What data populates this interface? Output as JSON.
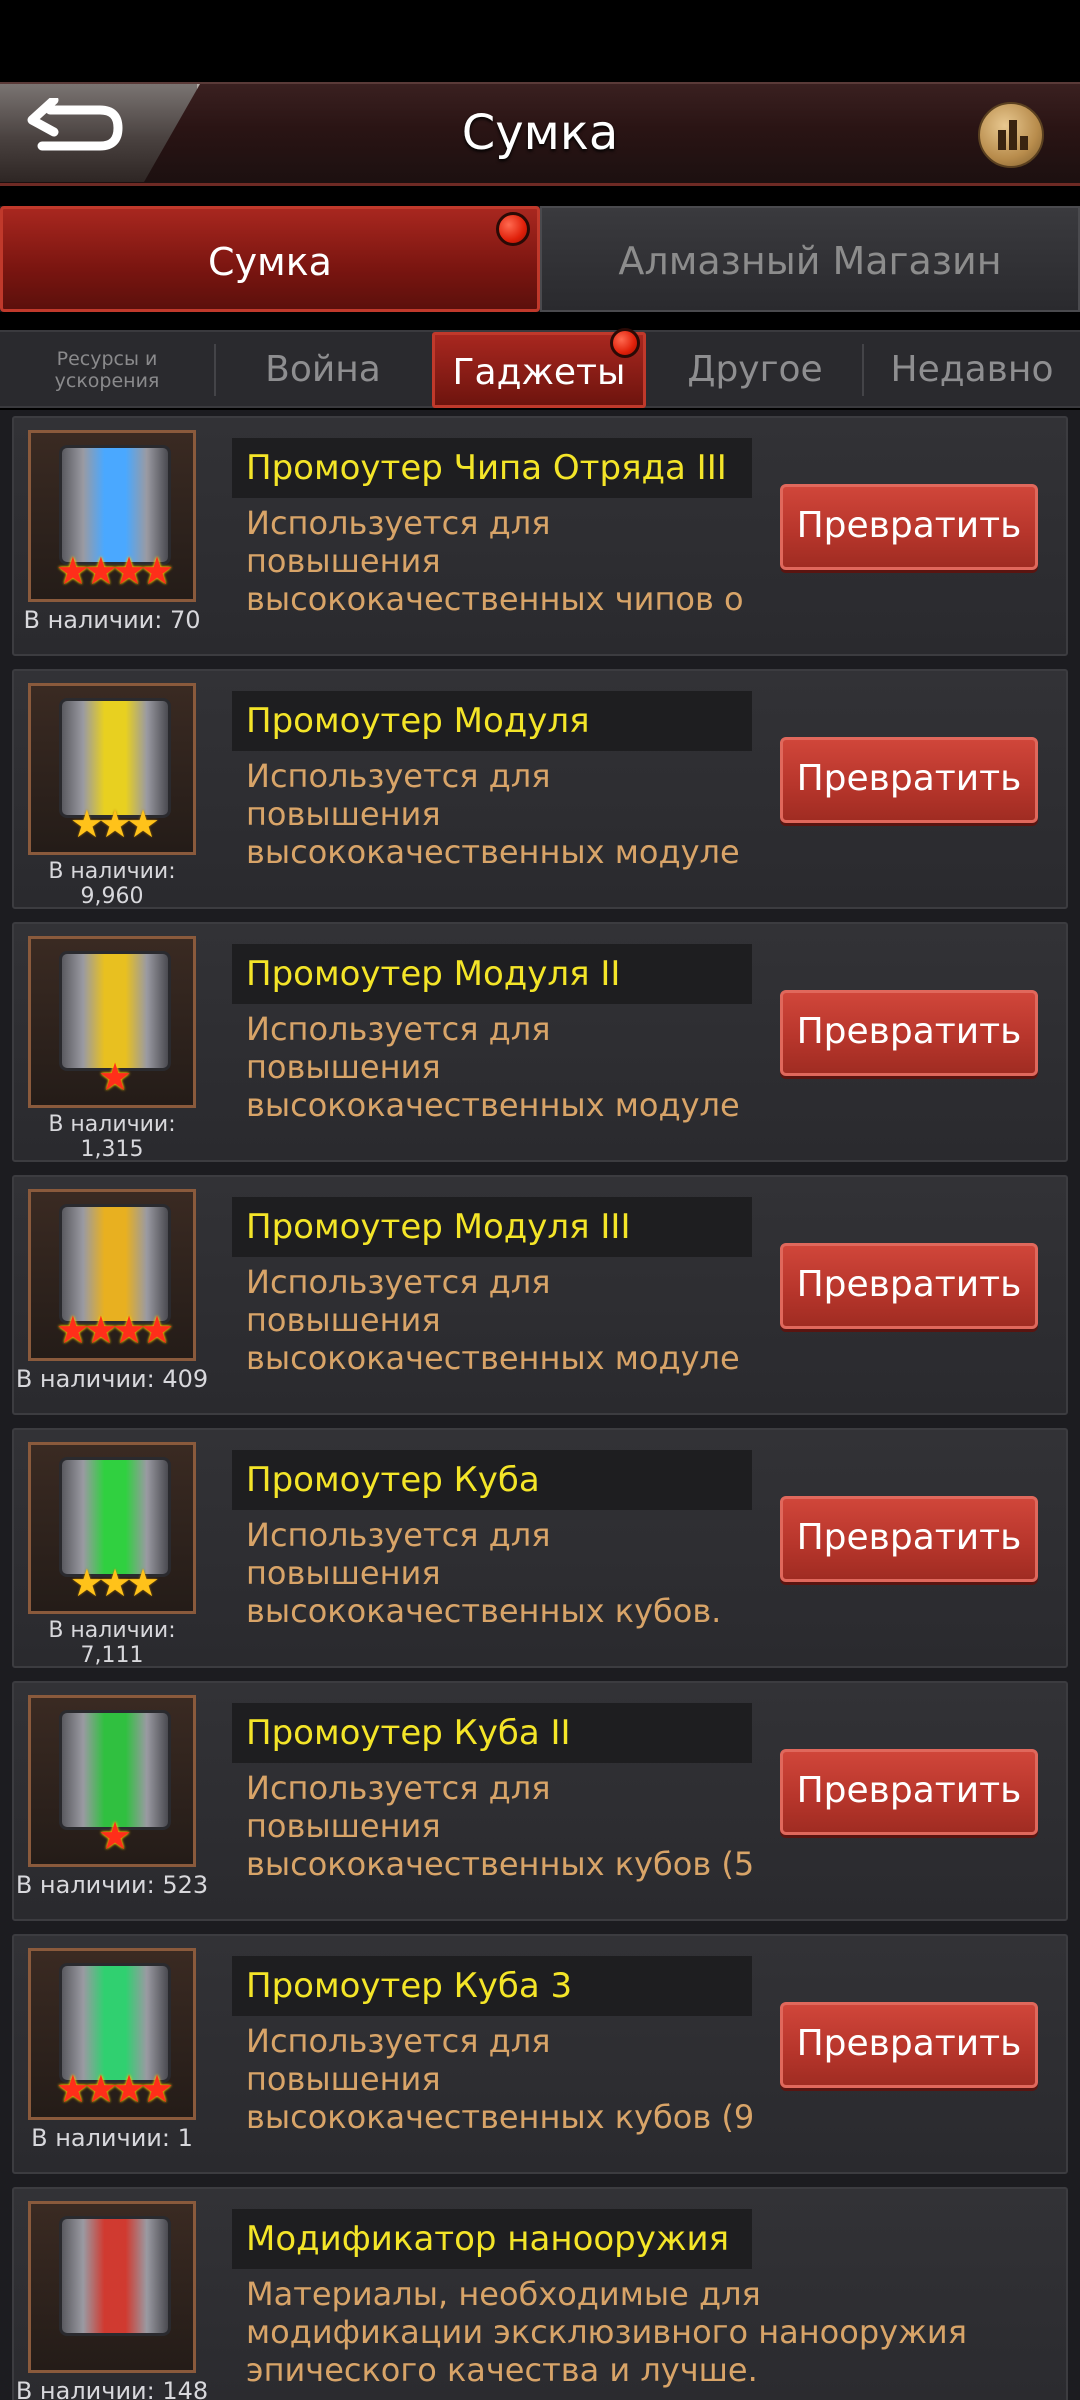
{
  "header": {
    "title": "Сумка",
    "back_icon": "back-arrow-icon",
    "stats_icon": "bar-chart-icon"
  },
  "top_tabs": [
    {
      "label": "Сумка",
      "active": true,
      "badge": true
    },
    {
      "label": "Алмазный Магазин",
      "active": false,
      "badge": false
    }
  ],
  "sub_tabs": [
    {
      "label": "Ресурсы и ускорения",
      "line1": "Ресурсы и",
      "line2": "ускорения",
      "active": false
    },
    {
      "label": "Война",
      "active": false
    },
    {
      "label": "Гаджеты",
      "active": true,
      "badge": true
    },
    {
      "label": "Другое",
      "active": false
    },
    {
      "label": "Недавно",
      "active": false
    }
  ],
  "convert_label": "Превратить",
  "items": [
    {
      "name": "Промоутер Чипа Отряда III",
      "desc": [
        "Используется для",
        "повышения",
        "высококачественных чипов о"
      ],
      "stock": "В наличии: 70",
      "stars": 4,
      "color": "#4aa8ff"
    },
    {
      "name": "Промоутер Модуля",
      "desc": [
        "Используется для",
        "повышения",
        "высококачественных модуле"
      ],
      "stock": "В наличии: 9,960",
      "stars": 3,
      "color": "#e8d020"
    },
    {
      "name": "Промоутер Модуля II",
      "desc": [
        "Используется для",
        "повышения",
        "высококачественных модуле"
      ],
      "stock": "В наличии: 1,315",
      "stars": 1,
      "color": "#e8c020"
    },
    {
      "name": "Промоутер Модуля III",
      "desc": [
        "Используется для",
        "повышения",
        "высококачественных модуле"
      ],
      "stock": "В наличии: 409",
      "stars": 4,
      "color": "#e8b020"
    },
    {
      "name": "Промоутер Куба",
      "desc": [
        "Используется для",
        "повышения",
        "высококачественных кубов."
      ],
      "stock": "В наличии: 7,111",
      "stars": 3,
      "color": "#30d040"
    },
    {
      "name": "Промоутер Куба II",
      "desc": [
        "Используется для",
        "повышения",
        "высококачественных кубов (5"
      ],
      "stock": "В наличии: 523",
      "stars": 1,
      "color": "#30c040"
    },
    {
      "name": "Промоутер Куба 3",
      "desc": [
        "Используется для",
        "повышения",
        "высококачественных кубов (9"
      ],
      "stock": "В наличии: 1",
      "stars": 4,
      "color": "#30d070"
    },
    {
      "name": "Модификатор нанооружия",
      "desc": [
        "Материалы, необходимые для",
        "модификации эксклюзивного нанооружия",
        "эпического качества и лучше."
      ],
      "stock": "В наличии: 148",
      "stars": 0,
      "color": "#d03a30"
    }
  ]
}
